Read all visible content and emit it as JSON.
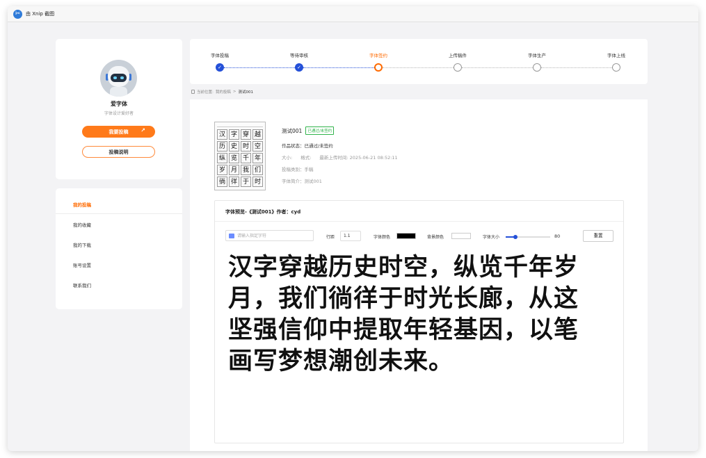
{
  "titlebar": {
    "title": "由 Xnip 截图"
  },
  "profile": {
    "name": "爱字体",
    "subtitle": "字体设计爱好者",
    "submit_button": "我要投稿",
    "guide_button": "投稿说明"
  },
  "menu": {
    "items": [
      {
        "label": "我的投稿",
        "active": true
      },
      {
        "label": "我的收藏"
      },
      {
        "label": "我的下载"
      },
      {
        "label": "账号设置"
      },
      {
        "label": "联系我们"
      }
    ]
  },
  "steps": [
    {
      "label": "字体投稿",
      "status": "done"
    },
    {
      "label": "等待审核",
      "status": "done"
    },
    {
      "label": "字体签约",
      "status": "current"
    },
    {
      "label": "上传稿件",
      "status": "pending"
    },
    {
      "label": "字体生产",
      "status": "pending"
    },
    {
      "label": "字体上线",
      "status": "pending"
    }
  ],
  "breadcrumb": {
    "prefix": "当前位置:",
    "parent": "我的投稿",
    "separator": ">",
    "current": "测试001"
  },
  "work": {
    "thumbnail_chars": [
      "汉",
      "字",
      "穿",
      "越",
      "历",
      "史",
      "时",
      "空",
      "纵",
      "览",
      "千",
      "年",
      "岁",
      "月",
      "我",
      "们",
      "徜",
      "徉",
      "于",
      "时"
    ],
    "title": "测试001",
    "badge": "已通过/未签约",
    "status_line": "作品状态：已通过/未签约",
    "size_label": "大小:",
    "format_label": "格式:",
    "upload_time": "最新上传时间: 2025-06-21 08:52:11",
    "category": "投稿类别：手稿",
    "intro": "字体简介：测试001"
  },
  "preview": {
    "title": "字体预览-《测试001》作者：cyd",
    "search_placeholder": "请输入指定字符",
    "line_spacing_label": "行距",
    "line_spacing_value": "1.1",
    "font_color_label": "字体颜色",
    "font_color": "#000000",
    "bg_color_label": "背景颜色",
    "bg_color": "#ffffff",
    "font_size_label": "字体大小",
    "font_size_value": "80",
    "font_size_fraction": 0.22,
    "reset_button": "重置",
    "sample_text": "汉字穿越历史时空，纵览千年岁月，我们徜徉于时光长廊，从这坚强信仰中提取年轻基因，以笔画写梦想潮创未来。"
  },
  "colors": {
    "accent": "#ff7a1a",
    "progress": "#2450d8",
    "badge": "#2fb34a"
  }
}
